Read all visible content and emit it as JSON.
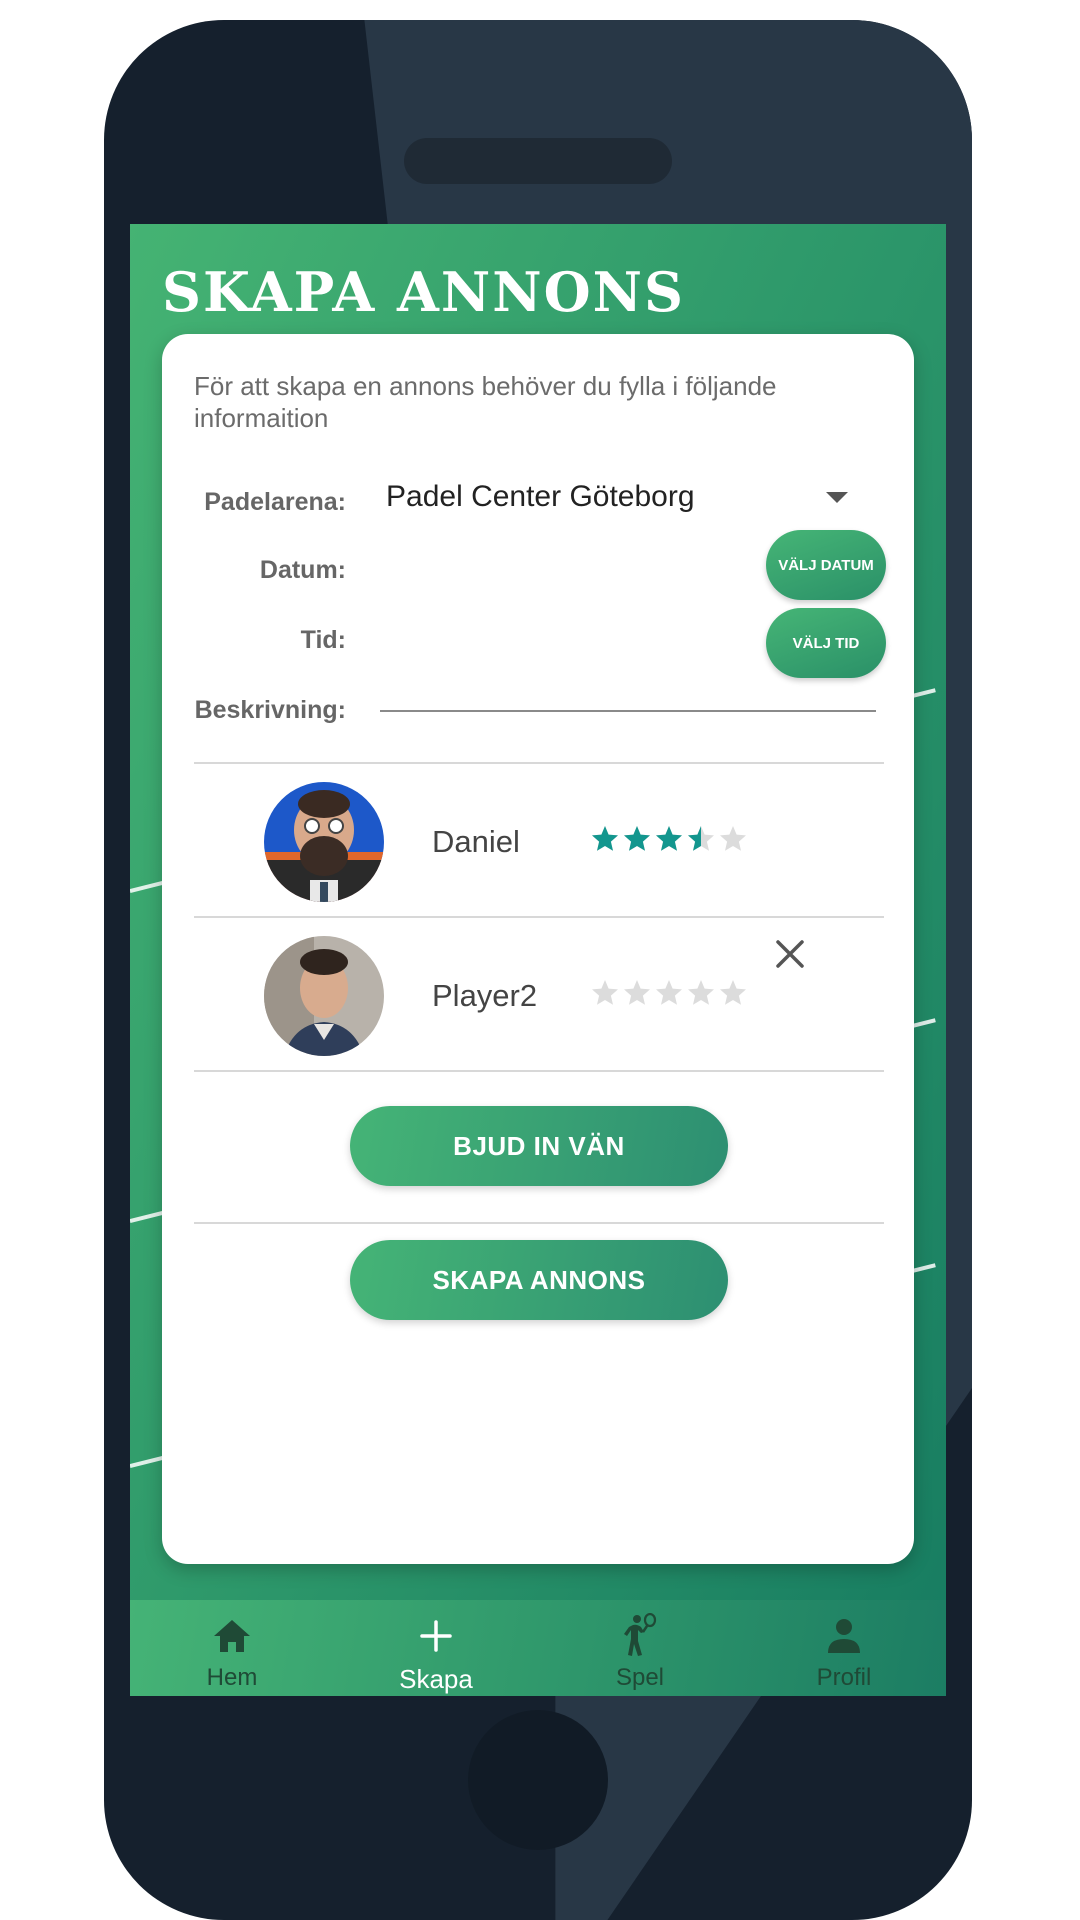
{
  "header": {
    "title": "SKAPA ANNONS"
  },
  "form": {
    "intro": "För att skapa en annons behöver du fylla i följande informaition",
    "arena_label": "Padelarena:",
    "arena_value": "Padel Center Göteborg",
    "date_label": "Datum:",
    "date_button": "VÄLJ DATUM",
    "time_label": "Tid:",
    "time_button": "VÄLJ TID",
    "description_label": "Beskrivning:",
    "description_value": ""
  },
  "players": [
    {
      "name": "Daniel",
      "rating": 3.5,
      "max_rating": 5,
      "removable": false
    },
    {
      "name": "Player2",
      "rating": 0,
      "max_rating": 5,
      "removable": true
    }
  ],
  "actions": {
    "invite_label": "BJUD IN VÄN",
    "create_label": "SKAPA ANNONS"
  },
  "nav": {
    "items": [
      {
        "label": "Hem",
        "icon": "home-icon",
        "active": false
      },
      {
        "label": "Skapa",
        "icon": "plus-icon",
        "active": true
      },
      {
        "label": "Spel",
        "icon": "padel-player-icon",
        "active": false
      },
      {
        "label": "Profil",
        "icon": "person-icon",
        "active": false
      }
    ]
  },
  "colors": {
    "accent": "#3aa86f",
    "accent_dark": "#177c61",
    "star_filled": "#13968e",
    "star_empty": "#dcdcdc",
    "phone_frame": "#15202d"
  }
}
